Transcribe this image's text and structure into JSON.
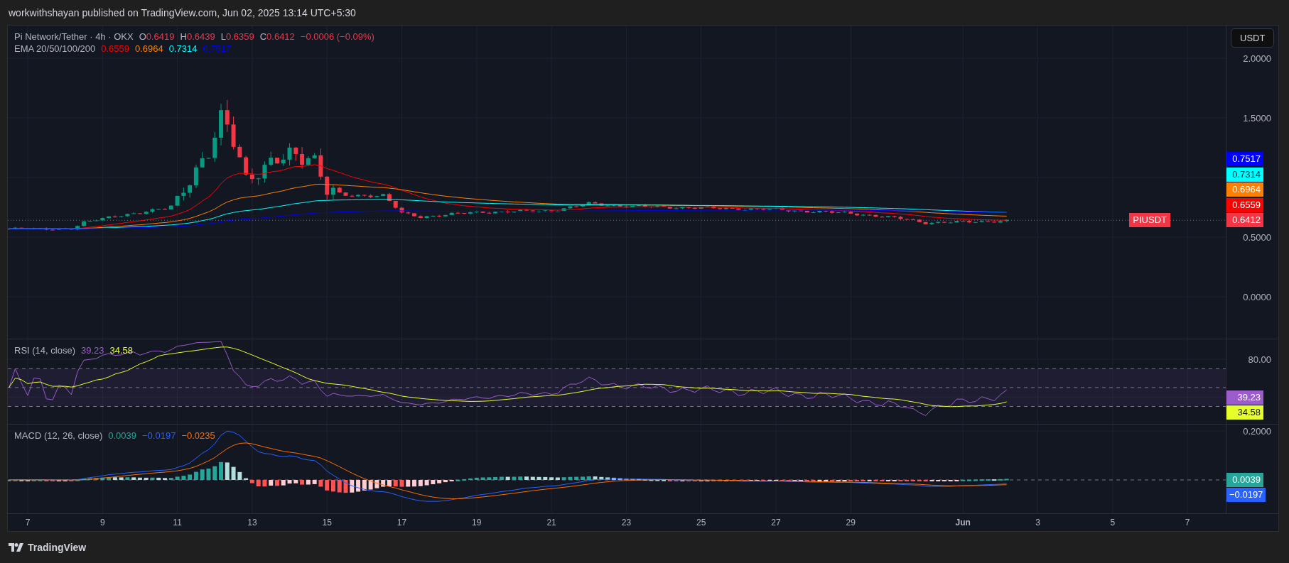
{
  "header": {
    "text": "workwithshayan published on TradingView.com, Jun 02, 2025 13:14 UTC+5:30"
  },
  "legend": {
    "symbol": "Pi Network/Tether · 4h · OKX",
    "falling": true,
    "ohlc": [
      {
        "label": "O",
        "value": "0.6419"
      },
      {
        "label": "H",
        "value": "0.6439"
      },
      {
        "label": "L",
        "value": "0.6359"
      },
      {
        "label": "C",
        "value": "0.6412"
      }
    ],
    "change": "−0.0006 (−0.09%)"
  },
  "ema_legend": {
    "label": "EMA 20/50/100/200",
    "values": [
      {
        "value": "0.6559",
        "color": "#ff0000"
      },
      {
        "value": "0.6964",
        "color": "#ff8000"
      },
      {
        "value": "0.7314",
        "color": "#00ffff"
      },
      {
        "value": "0.7517",
        "color": "#0000ff"
      }
    ]
  },
  "currency_button": "USDT",
  "price_axis": {
    "ticks": [
      "2.0000",
      "1.5000",
      "0.5000",
      "0.0000"
    ],
    "symbol_tag": "PIUSDT",
    "tags": [
      {
        "label": "0.7517",
        "color": "#0000ff"
      },
      {
        "label": "0.7314",
        "color": "#00ffff"
      },
      {
        "label": "0.6964",
        "color": "#ff8000"
      },
      {
        "label": "0.6559",
        "color": "#ff0000"
      },
      {
        "label": "0.6412",
        "color": "#f23645"
      }
    ]
  },
  "rsi": {
    "label": "RSI (14, close)",
    "values": [
      {
        "value": "39.23",
        "color": "#9c5ccc"
      },
      {
        "value": "34.58",
        "color": "#e6ff29"
      }
    ],
    "tick": "80.00",
    "tags": [
      {
        "label": "39.23",
        "color": "#9c5ccc"
      },
      {
        "label": "34.58",
        "color": "#e6ff29"
      }
    ]
  },
  "macd": {
    "label": "MACD (12, 26, close)",
    "values": [
      {
        "value": "0.0039",
        "color": "#26a69a"
      },
      {
        "value": "−0.0197",
        "color": "#2962ff"
      },
      {
        "value": "−0.0235",
        "color": "#ff6d00"
      }
    ],
    "tick": "0.2000",
    "tags": [
      {
        "label": "0.0039",
        "color": "#26a69a"
      },
      {
        "label": "−0.0197",
        "color": "#2962ff"
      }
    ]
  },
  "time_axis": [
    {
      "label": "7",
      "kind": "day"
    },
    {
      "label": "9",
      "kind": "day"
    },
    {
      "label": "11",
      "kind": "day"
    },
    {
      "label": "13",
      "kind": "day"
    },
    {
      "label": "15",
      "kind": "day"
    },
    {
      "label": "17",
      "kind": "day"
    },
    {
      "label": "19",
      "kind": "day"
    },
    {
      "label": "21",
      "kind": "day"
    },
    {
      "label": "23",
      "kind": "day"
    },
    {
      "label": "25",
      "kind": "day"
    },
    {
      "label": "27",
      "kind": "day"
    },
    {
      "label": "29",
      "kind": "day"
    },
    {
      "label": "Jun",
      "kind": "month"
    },
    {
      "label": "3",
      "kind": "day"
    },
    {
      "label": "5",
      "kind": "day"
    },
    {
      "label": "7",
      "kind": "day"
    }
  ],
  "footer": {
    "brand": "TradingView"
  }
}
